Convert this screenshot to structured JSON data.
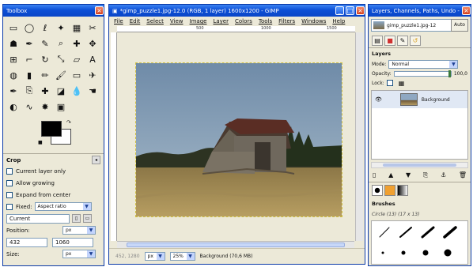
{
  "toolbox": {
    "title": "Toolbox",
    "tools": [
      {
        "name": "rect-select-icon",
        "glyph": "▭"
      },
      {
        "name": "ellipse-select-icon",
        "glyph": "◯"
      },
      {
        "name": "free-select-icon",
        "glyph": "ℓ"
      },
      {
        "name": "fuzzy-select-icon",
        "glyph": "✦"
      },
      {
        "name": "color-select-icon",
        "glyph": "▦"
      },
      {
        "name": "scissors-select-icon",
        "glyph": "✂"
      },
      {
        "name": "foreground-select-icon",
        "glyph": "☗"
      },
      {
        "name": "paths-icon",
        "glyph": "✒"
      },
      {
        "name": "color-picker-icon",
        "glyph": "✎"
      },
      {
        "name": "zoom-icon",
        "glyph": "⌕"
      },
      {
        "name": "measure-icon",
        "glyph": "✚"
      },
      {
        "name": "move-icon",
        "glyph": "✥"
      },
      {
        "name": "align-icon",
        "glyph": "⊞"
      },
      {
        "name": "crop-icon",
        "glyph": "⌐"
      },
      {
        "name": "rotate-icon",
        "glyph": "↻"
      },
      {
        "name": "scale-icon",
        "glyph": "⤡"
      },
      {
        "name": "shear-icon",
        "glyph": "▱"
      },
      {
        "name": "text-icon",
        "glyph": "A"
      },
      {
        "name": "bucket-fill-icon",
        "glyph": "◍"
      },
      {
        "name": "blend-icon",
        "glyph": "▮"
      },
      {
        "name": "pencil-icon",
        "glyph": "✏"
      },
      {
        "name": "paintbrush-icon",
        "glyph": "🖌"
      },
      {
        "name": "eraser-icon",
        "glyph": "▭"
      },
      {
        "name": "airbrush-icon",
        "glyph": "✈"
      },
      {
        "name": "ink-icon",
        "glyph": "✒"
      },
      {
        "name": "clone-icon",
        "glyph": "⎘"
      },
      {
        "name": "heal-icon",
        "glyph": "✚"
      },
      {
        "name": "perspective-clone-icon",
        "glyph": "◪"
      },
      {
        "name": "blur-icon",
        "glyph": "💧"
      },
      {
        "name": "smudge-icon",
        "glyph": "☚"
      },
      {
        "name": "dodge-icon",
        "glyph": "◐"
      },
      {
        "name": "lasso-icon",
        "glyph": "∿"
      },
      {
        "name": "star-icon",
        "glyph": "✸"
      },
      {
        "name": "stamp-icon",
        "glyph": "▣"
      }
    ],
    "crop": {
      "title": "Crop",
      "current_layer_only": "Current layer only",
      "allow_growing": "Allow growing",
      "expand_from_center": "Expand from center",
      "fixed_label": "Fixed:",
      "fixed_value": "Aspect ratio",
      "ratio_value": "Current",
      "position_label": "Position:",
      "position_unit": "px",
      "pos_x": "432",
      "pos_y": "1060",
      "size_label": "Size:",
      "size_unit": "px"
    }
  },
  "image_window": {
    "title": "*gimp_puzzle1.jpg-12.0 (RGB, 1 layer) 1600x1200 - GIMP",
    "menu": [
      "File",
      "Edit",
      "Select",
      "View",
      "Image",
      "Layer",
      "Colors",
      "Tools",
      "Filters",
      "Windows",
      "Help"
    ],
    "ruler_labels": [
      "500",
      "1000",
      "1500"
    ],
    "status": {
      "coords": "452, 1280",
      "unit": "px",
      "zoom": "25%",
      "info": "Background (70,6 MB)"
    }
  },
  "layers_dock": {
    "title": "Layers, Channels, Paths, Undo - ...",
    "image_selector": "gimp_puzzle1.jpg-12",
    "auto_label": "Auto",
    "panel_title": "Layers",
    "mode_label": "Mode:",
    "mode_value": "Normal",
    "opacity_label": "Opacity:",
    "opacity_value": "100,0",
    "lock_label": "Lock:",
    "layers": [
      {
        "name": "Background"
      }
    ],
    "brushes_title": "Brushes",
    "brush_name": "Circle (13) (17 x 13)"
  }
}
